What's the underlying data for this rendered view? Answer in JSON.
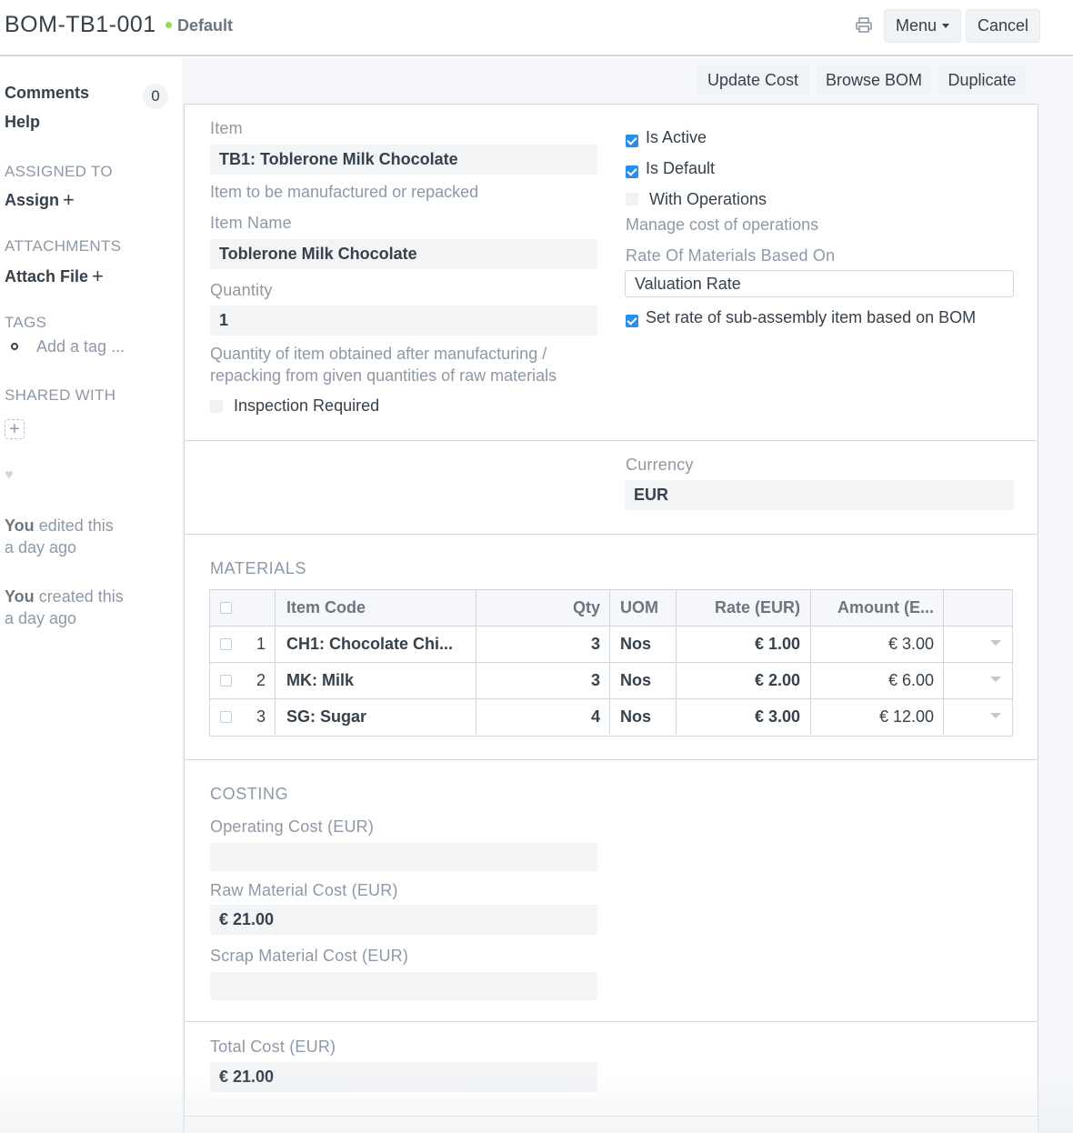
{
  "header": {
    "title": "BOM-TB1-001",
    "status": "Default",
    "menu_label": "Menu",
    "cancel_label": "Cancel",
    "status_color": "#98d85b",
    "print_icon": "printer-icon"
  },
  "sidebar": {
    "comments_label": "Comments",
    "comments_count": "0",
    "help_label": "Help",
    "assigned_heading": "ASSIGNED TO",
    "assign_label": "Assign",
    "attachments_heading": "ATTACHMENTS",
    "attach_label": "Attach File",
    "tags_heading": "TAGS",
    "tag_placeholder": "Add a tag ...",
    "shared_heading": "SHARED WITH",
    "activity": [
      {
        "actor": "You",
        "action": "edited this",
        "when": "a day ago"
      },
      {
        "actor": "You",
        "action": "created this",
        "when": "a day ago"
      }
    ]
  },
  "actions": {
    "update_cost": "Update Cost",
    "browse_bom": "Browse BOM",
    "duplicate": "Duplicate"
  },
  "form": {
    "item_label": "Item",
    "item_value": "TB1: Toblerone Milk Chocolate",
    "item_desc": "Item to be manufactured or repacked",
    "item_name_label": "Item Name",
    "item_name_value": "Toblerone Milk Chocolate",
    "quantity_label": "Quantity",
    "quantity_value": "1",
    "quantity_desc_line1": "Quantity of item obtained after manufacturing /",
    "quantity_desc_line2": "repacking from given quantities of raw materials",
    "inspection_label": "Inspection Required",
    "inspection_checked": false,
    "is_active_label": "Is Active",
    "is_active_checked": true,
    "is_default_label": "Is Default",
    "is_default_checked": true,
    "with_operations_label": "With Operations",
    "with_operations_checked": false,
    "with_operations_desc": "Manage cost of operations",
    "rate_based_label": "Rate Of Materials Based On",
    "rate_based_value": "Valuation Rate",
    "set_rate_label": "Set rate of sub-assembly item based on BOM",
    "set_rate_checked": true,
    "currency_label": "Currency",
    "currency_value": "EUR"
  },
  "materials": {
    "title": "MATERIALS",
    "columns": [
      "Item Code",
      "Qty",
      "UOM",
      "Rate (EUR)",
      "Amount (E..."
    ],
    "rows": [
      {
        "idx": "1",
        "item_code": "CH1: Chocolate Chi...",
        "qty": "3",
        "uom": "Nos",
        "rate": "€ 1.00",
        "amount": "€ 3.00"
      },
      {
        "idx": "2",
        "item_code": "MK: Milk",
        "qty": "3",
        "uom": "Nos",
        "rate": "€ 2.00",
        "amount": "€ 6.00"
      },
      {
        "idx": "3",
        "item_code": "SG: Sugar",
        "qty": "4",
        "uom": "Nos",
        "rate": "€ 3.00",
        "amount": "€ 12.00"
      }
    ]
  },
  "costing": {
    "title": "COSTING",
    "operating_label": "Operating Cost (EUR)",
    "operating_value": "",
    "raw_label": "Raw Material Cost (EUR)",
    "raw_value": "€ 21.00",
    "scrap_label": "Scrap Material Cost (EUR)",
    "scrap_value": "",
    "total_label": "Total Cost (EUR)",
    "total_value": "€ 21.00"
  },
  "colors": {
    "checkbox_on": "#2490ef",
    "muted_text": "#8d99a6",
    "text": "#36414c"
  }
}
